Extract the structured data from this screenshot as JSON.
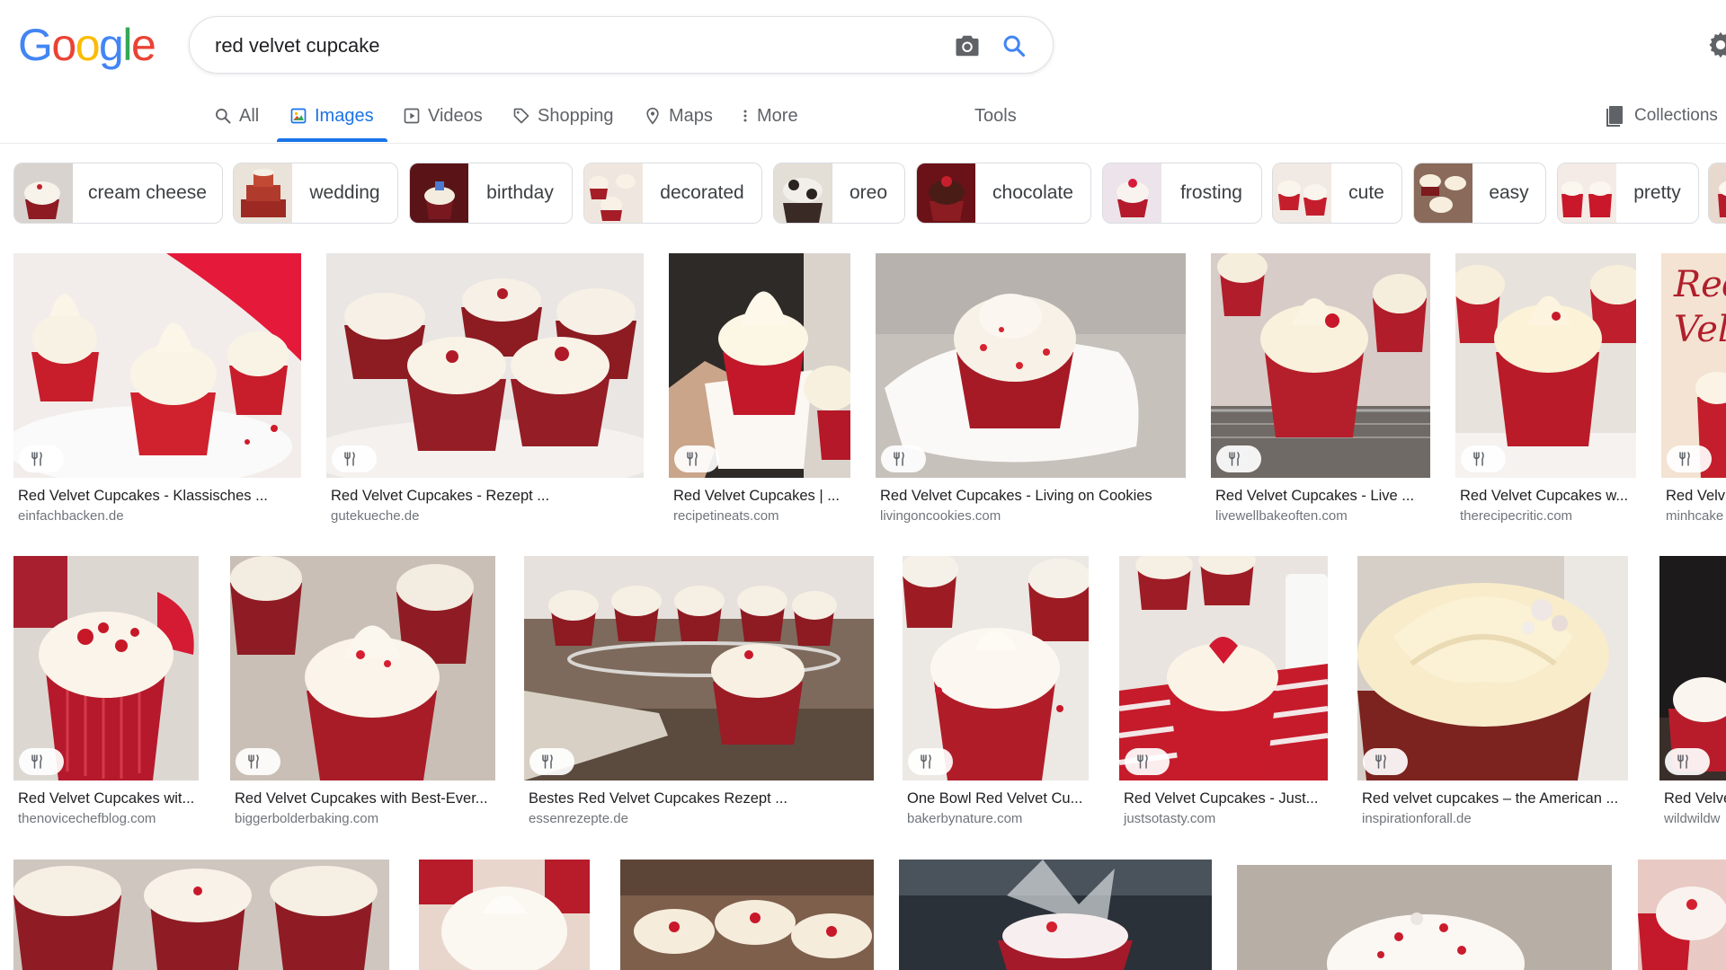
{
  "logo": {
    "letters": [
      "G",
      "o",
      "o",
      "g",
      "l",
      "e"
    ],
    "colors": [
      "#4285f4",
      "#ea4335",
      "#fbbc05",
      "#4285f4",
      "#34a853",
      "#ea4335"
    ]
  },
  "search": {
    "query": "red velvet cupcake",
    "camera_icon": "camera-icon",
    "search_icon": "search-icon"
  },
  "settings": {
    "icon": "gear-icon"
  },
  "nav": {
    "tabs": [
      {
        "label": "All",
        "icon": "search-icon"
      },
      {
        "label": "Images",
        "icon": "image-icon",
        "active": true
      },
      {
        "label": "Videos",
        "icon": "play-icon"
      },
      {
        "label": "Shopping",
        "icon": "tag-icon"
      },
      {
        "label": "Maps",
        "icon": "pin-icon"
      },
      {
        "label": "More",
        "icon": "kebab-icon"
      }
    ],
    "tools_label": "Tools",
    "collections_label": "Collections",
    "accent_color": "#1a73e8"
  },
  "chips": [
    {
      "label": "cream cheese"
    },
    {
      "label": "wedding"
    },
    {
      "label": "birthday"
    },
    {
      "label": "decorated"
    },
    {
      "label": "oreo"
    },
    {
      "label": "chocolate"
    },
    {
      "label": "frosting"
    },
    {
      "label": "cute"
    },
    {
      "label": "easy"
    },
    {
      "label": "pretty"
    }
  ],
  "results": {
    "row1": [
      {
        "title": "Red Velvet Cupcakes - Klassisches ...",
        "source": "einfachbacken.de"
      },
      {
        "title": "Red Velvet Cupcakes - Rezept ...",
        "source": "gutekueche.de"
      },
      {
        "title": "Red Velvet Cupcakes | ...",
        "source": "recipetineats.com"
      },
      {
        "title": "Red Velvet Cupcakes - Living on Cookies",
        "source": "livingoncookies.com"
      },
      {
        "title": "Red Velvet Cupcakes - Live ...",
        "source": "livewellbakeoften.com"
      },
      {
        "title": "Red Velvet Cupcakes w...",
        "source": "therecipecritic.com"
      },
      {
        "title": "Red Velv",
        "source": "minhcake"
      }
    ],
    "row2": [
      {
        "title": "Red Velvet Cupcakes wit...",
        "source": "thenovicechefblog.com"
      },
      {
        "title": "Red Velvet Cupcakes with Best-Ever...",
        "source": "biggerbolderbaking.com"
      },
      {
        "title": "Bestes Red Velvet Cupcakes Rezept ...",
        "source": "essenrezepte.de"
      },
      {
        "title": "One Bowl Red Velvet Cu...",
        "source": "bakerbynature.com"
      },
      {
        "title": "Red Velvet Cupcakes - Just...",
        "source": "justsotasty.com"
      },
      {
        "title": "Red velvet cupcakes – the American ...",
        "source": "inspirationforall.de"
      },
      {
        "title": "Red Velve",
        "source": "wildwildw"
      }
    ],
    "badge_icon": "recipe-icon"
  }
}
